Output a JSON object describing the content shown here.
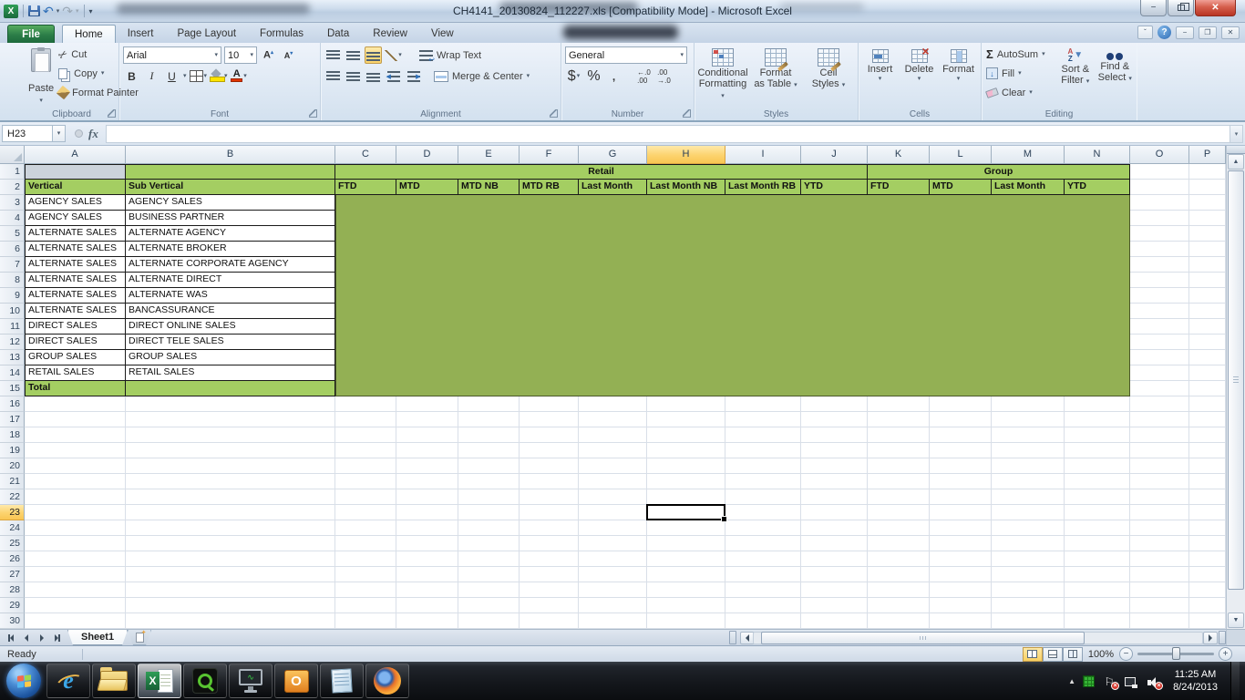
{
  "colors": {
    "green_light": "#a4ce62",
    "green_block": "#93b054",
    "sel_orange": "#fcd36e",
    "file_green": "#2b7d48",
    "close_red": "#b83524",
    "gridline": "#d9dfe8"
  },
  "title_bar": {
    "title": "CH4141_20130824_112227.xls  [Compatibility Mode]  -  Microsoft Excel"
  },
  "ribbon": {
    "tabs": [
      {
        "label": "File",
        "active": false
      },
      {
        "label": "Home",
        "active": true
      },
      {
        "label": "Insert",
        "active": false
      },
      {
        "label": "Page Layout",
        "active": false
      },
      {
        "label": "Formulas",
        "active": false
      },
      {
        "label": "Data",
        "active": false
      },
      {
        "label": "Review",
        "active": false
      },
      {
        "label": "View",
        "active": false
      }
    ],
    "clipboard": {
      "label": "Clipboard",
      "paste": "Paste",
      "cut": "Cut",
      "copy": "Copy",
      "format_painter": "Format Painter"
    },
    "font": {
      "label": "Font",
      "family": "Arial",
      "size": "10",
      "bold": "B",
      "italic": "I",
      "underline": "U"
    },
    "alignment": {
      "label": "Alignment",
      "wrap_text": "Wrap Text",
      "merge_center": "Merge & Center"
    },
    "number": {
      "label": "Number",
      "format": "General",
      "currency": "$",
      "percent": "%",
      "comma": ","
    },
    "styles": {
      "label": "Styles",
      "conditional_line1": "Conditional",
      "conditional_line2": "Formatting",
      "format_table_line1": "Format",
      "format_table_line2": "as Table",
      "cell_styles_line1": "Cell",
      "cell_styles_line2": "Styles"
    },
    "cells": {
      "label": "Cells",
      "insert": "Insert",
      "delete": "Delete",
      "format": "Format"
    },
    "editing": {
      "label": "Editing",
      "autosum": "AutoSum",
      "fill": "Fill",
      "clear": "Clear",
      "sort_line1": "Sort &",
      "sort_line2": "Filter",
      "find_line1": "Find &",
      "find_line2": "Select"
    }
  },
  "formula_bar": {
    "name_box": "H23",
    "fx_label": "fx",
    "formula": ""
  },
  "sheet": {
    "columns": [
      "A",
      "B",
      "C",
      "D",
      "E",
      "F",
      "G",
      "H",
      "I",
      "J",
      "K",
      "L",
      "M",
      "N",
      "O",
      "P"
    ],
    "selected_cell": "H23",
    "selected_column": "H",
    "selected_row": 23,
    "visible_rows": 30,
    "band_headers": [
      {
        "label": "Retail",
        "start": 2,
        "count": 8
      },
      {
        "label": "Group",
        "start": 10,
        "count": 4
      }
    ],
    "header_row": [
      "Vertical",
      "Sub Vertical",
      "FTD",
      "MTD",
      "MTD NB",
      "MTD RB",
      "Last Month",
      "Last Month NB",
      "Last Month RB",
      "YTD",
      "FTD",
      "MTD",
      "Last Month",
      "YTD"
    ],
    "data_rows": [
      [
        "AGENCY SALES",
        "AGENCY SALES"
      ],
      [
        "AGENCY SALES",
        "BUSINESS PARTNER"
      ],
      [
        "ALTERNATE SALES",
        "ALTERNATE AGENCY"
      ],
      [
        "ALTERNATE SALES",
        "ALTERNATE BROKER"
      ],
      [
        "ALTERNATE SALES",
        "ALTERNATE CORPORATE AGENCY"
      ],
      [
        "ALTERNATE SALES",
        "ALTERNATE DIRECT"
      ],
      [
        "ALTERNATE SALES",
        "ALTERNATE WAS"
      ],
      [
        "ALTERNATE SALES",
        "BANCASSURANCE"
      ],
      [
        "DIRECT SALES",
        "DIRECT ONLINE SALES"
      ],
      [
        "DIRECT SALES",
        "DIRECT TELE SALES"
      ],
      [
        "GROUP SALES",
        "GROUP SALES"
      ],
      [
        "RETAIL SALES",
        "RETAIL SALES"
      ]
    ],
    "total_label": "Total"
  },
  "sheet_tabs": {
    "sheet1": "Sheet1"
  },
  "status_bar": {
    "status": "Ready",
    "zoom_level": "100%"
  },
  "taskbar": {
    "time": "11:25 AM",
    "date": "8/24/2013"
  }
}
